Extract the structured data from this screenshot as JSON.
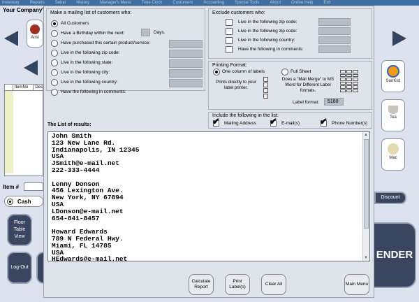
{
  "menu": [
    "Inventory",
    "Reports",
    "Setup",
    "History",
    "Manager's Menu",
    "Time Clock",
    "Customers",
    "Accounting",
    "Special Tools",
    "About",
    "Online Help",
    "Exit"
  ],
  "background": {
    "title": "Your Company's",
    "item_label": "Item #",
    "cash_label": "Cash",
    "floor_label": "Floor Table View",
    "logout_label": "Log-Out",
    "discount_label": "Discount",
    "tender_label": "ENDER",
    "table_headers": [
      "ItemNo",
      "Des"
    ],
    "products": [
      {
        "name": "SunKist"
      },
      {
        "name": "Tea"
      },
      {
        "name": "Mac"
      }
    ],
    "left_product": "Ansi"
  },
  "mailing": {
    "title": "Make a mailing list of customers who:",
    "options": [
      "All Customers",
      "Have a Birthday within the next:",
      "Have purchased this certain product/service:",
      "Live in the following zip code:",
      "Live in the following state:",
      "Live in the following city:",
      "Live in the following country:",
      "Have the following in comments:"
    ],
    "selected_index": 0,
    "days_label": "Days."
  },
  "exclude": {
    "title": "Exclude customers who:",
    "options": [
      "Live in the following zip code:",
      "Live in the following zip code:",
      "Live in the following country:",
      "Have the following in comments:"
    ]
  },
  "printing": {
    "title": "Printing Format:",
    "option_one": "One column of labels",
    "option_full": "Full Sheet",
    "selected": "one",
    "desc_one": "Prints directly to your label printer.",
    "desc_full": "Does a \"Mail Merge\" to MS Word for Different Label formats.",
    "label_format_label": "Label format:",
    "label_format_value": "5160"
  },
  "include": {
    "title": "Include the following in the list:",
    "items": [
      "Mailing Address",
      "E-mail(s)",
      "Phone Number(s)"
    ]
  },
  "results": {
    "title": "The List of results:",
    "text": "John Smith\n123 New Lane Rd.\nIndianapolis, IN 12345\nUSA\nJSmith@e-mail.net\n222-333-4444\n\nLenny Donson\n456 Lexington Ave.\nNew York, NY 67894\nUSA\nLDonson@e-mail.net\n654-841-8457\n\nHoward Edwards\n789 N Federal Hwy.\nMiami, FL 14785\nUSA\nHEdwards@e-mail.net"
  },
  "buttons": {
    "calculate": "Calculate Report",
    "print": "Print Label(s)",
    "clear": "Clear All",
    "main": "Main Menu"
  }
}
